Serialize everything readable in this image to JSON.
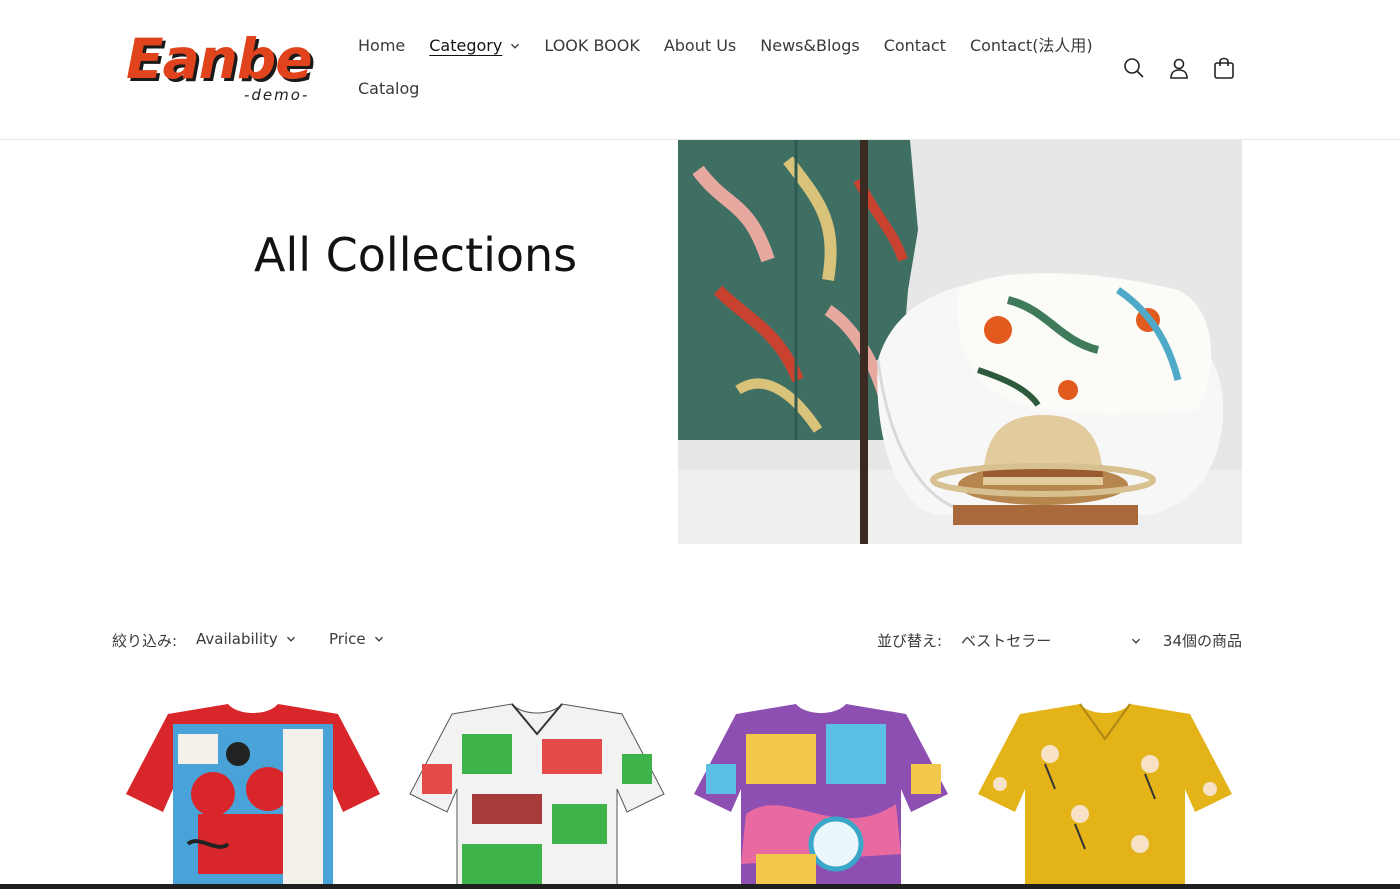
{
  "logo": {
    "main": "Eanbe",
    "sub": "-demo-"
  },
  "nav": {
    "row1": [
      {
        "label": "Home"
      },
      {
        "label": "Category"
      },
      {
        "label": "LOOK BOOK"
      },
      {
        "label": "About Us"
      },
      {
        "label": "News&Blogs"
      },
      {
        "label": "Contact"
      },
      {
        "label": "Contact(法人用)"
      }
    ],
    "row2": [
      {
        "label": "Catalog"
      }
    ],
    "active": "Category"
  },
  "header_icons": [
    "search-icon",
    "account-icon",
    "cart-icon"
  ],
  "hero": {
    "title": "All Collections"
  },
  "filters": {
    "label": "絞り込み:",
    "availability": "Availability",
    "price": "Price",
    "sort_label": "並び替え:",
    "sort_value": "ベストセラー",
    "count": "34個の商品"
  },
  "colors": {
    "logo_red": "#e1441c",
    "text": "#121212",
    "shirt1": "#d8262a",
    "shirt2": "#f2f2f2",
    "shirt3": "#8e4fb3",
    "shirt4": "#e3b318"
  }
}
